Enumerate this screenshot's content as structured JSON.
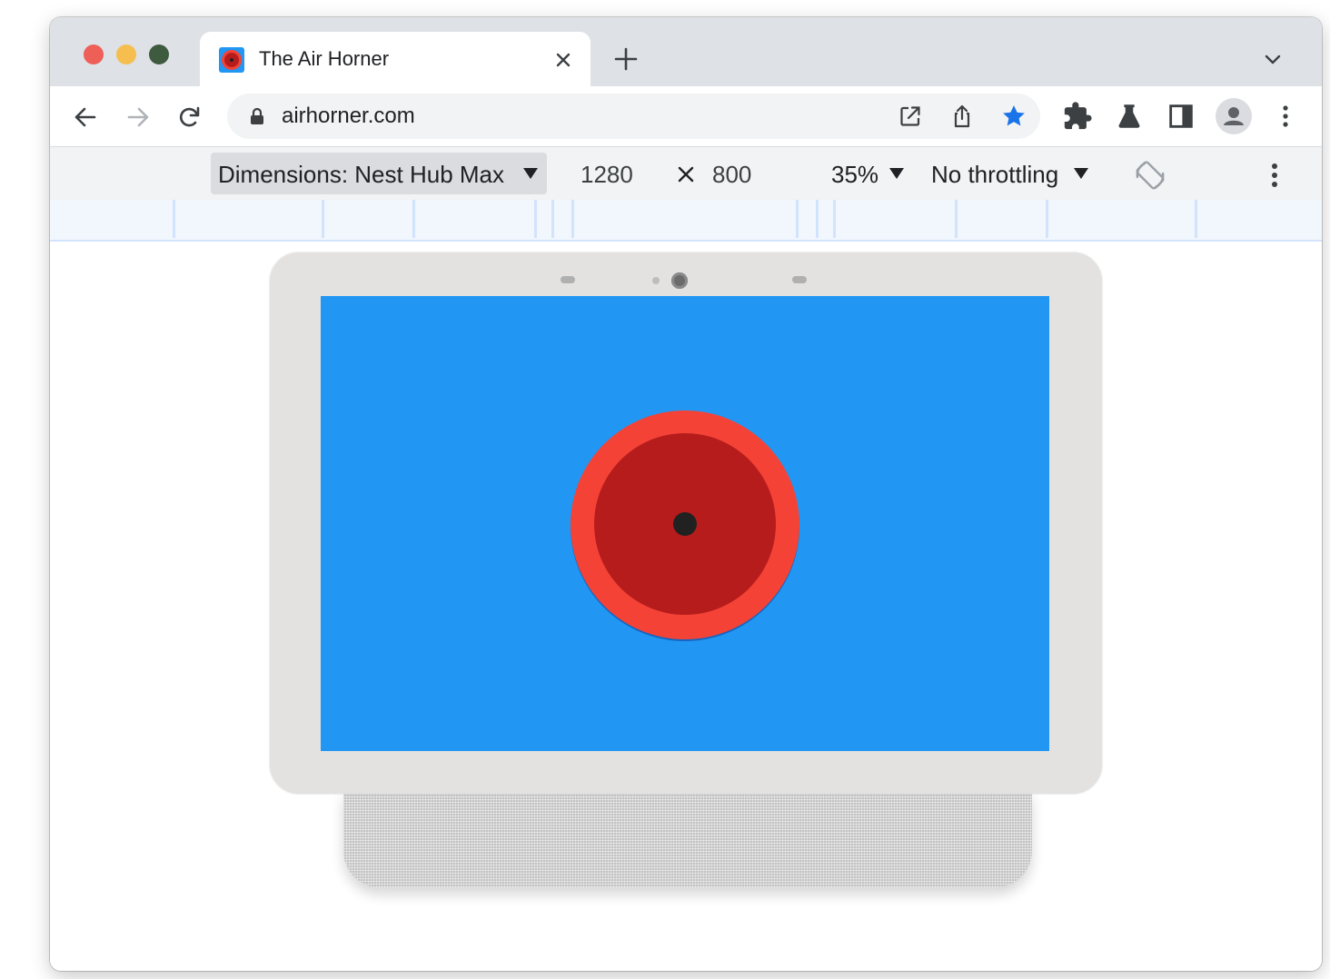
{
  "window": {
    "traffic_lights": [
      "close",
      "minimize",
      "maximize"
    ]
  },
  "tab": {
    "title": "The Air Horner",
    "favicon": "air-horner-favicon"
  },
  "toolbar": {
    "url": "airhorner.com",
    "icons": [
      "back-icon",
      "forward-icon",
      "reload-icon",
      "lock-icon",
      "open-in-new-icon",
      "share-icon",
      "bookmark-star-icon",
      "extensions-puzzle-icon",
      "labs-flask-icon",
      "side-panel-icon",
      "profile-avatar-icon",
      "more-vert-icon"
    ],
    "bookmarked": true,
    "accent_color": "#1a73e8"
  },
  "devtools": {
    "dimensions_label": "Dimensions: Nest Hub Max",
    "width": "1280",
    "separator": "×",
    "height": "800",
    "zoom": "35%",
    "throttling": "No throttling",
    "icons": [
      "rotate-icon",
      "more-vert-icon"
    ]
  },
  "device": {
    "name": "Nest Hub Max",
    "screen_color": "#2196f3",
    "button_outer_color": "#f44336",
    "button_inner_color": "#b71c1c"
  }
}
